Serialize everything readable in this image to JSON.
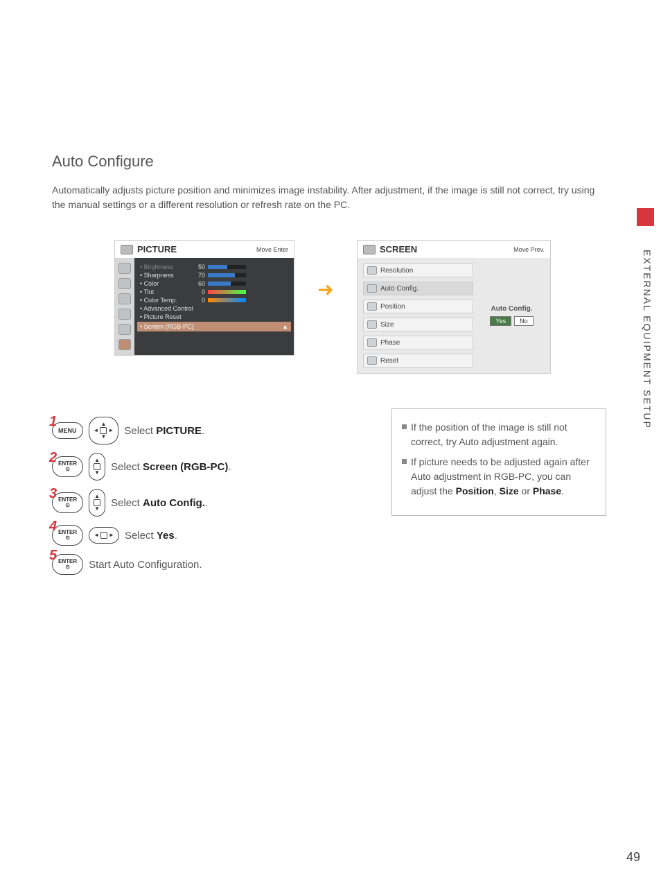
{
  "sideTab": {
    "label": "EXTERNAL EQUIPMENT SETUP"
  },
  "section": {
    "title": "Auto Configure",
    "desc": "Automatically adjusts picture position and minimizes image instability. After adjustment, if the image is still not correct, try using the manual settings or a different resolution or refresh rate on the PC."
  },
  "picturePanel": {
    "title": "PICTURE",
    "headerRight": "Move    Enter",
    "items": [
      {
        "name": "• Brightness",
        "value": "50",
        "fill": 50,
        "dim": true
      },
      {
        "name": "• Sharpness",
        "value": "70",
        "fill": 70
      },
      {
        "name": "• Color",
        "value": "60",
        "fill": 60
      },
      {
        "name": "• Tint",
        "value": "0",
        "bar": "tint"
      },
      {
        "name": "• Color Temp.",
        "value": "0",
        "bar": "ctemp"
      },
      {
        "name": "• Advanced Control"
      },
      {
        "name": "• Picture Reset"
      }
    ],
    "selected": "• Screen (RGB-PC)"
  },
  "screenPanel": {
    "title": "SCREEN",
    "headerRight": "Move    Prev.",
    "items": [
      "Resolution",
      "Auto Config.",
      "Position",
      "Size",
      "Phase",
      "Reset"
    ],
    "selectedIndex": 1,
    "rightTitle": "Auto Config.",
    "yes": "Yes",
    "no": "No"
  },
  "steps": {
    "s1": {
      "btn": "MENU",
      "text_pre": "Select ",
      "text_bold": "PICTURE",
      "text_post": "."
    },
    "s2": {
      "btn": "ENTER",
      "text_pre": "Select ",
      "text_bold": "Screen (RGB-PC)",
      "text_post": "."
    },
    "s3": {
      "btn": "ENTER",
      "text_pre": "Select ",
      "text_bold": "Auto Config.",
      "text_post": "."
    },
    "s4": {
      "btn": "ENTER",
      "text_pre": "Select ",
      "text_bold": "Yes",
      "text_post": "."
    },
    "s5": {
      "btn": "ENTER",
      "text": "Start Auto Configuration."
    }
  },
  "notes": {
    "n1": "If the position of the image is still not correct, try Auto adjustment again.",
    "n2_pre": "If picture needs to be adjusted again after Auto adjustment in RGB-PC, you can adjust the ",
    "n2_b1": "Position",
    "n2_c1": ", ",
    "n2_b2": "Size",
    "n2_c2": " or ",
    "n2_b3": "Phase",
    "n2_post": "."
  },
  "pageNum": "49"
}
